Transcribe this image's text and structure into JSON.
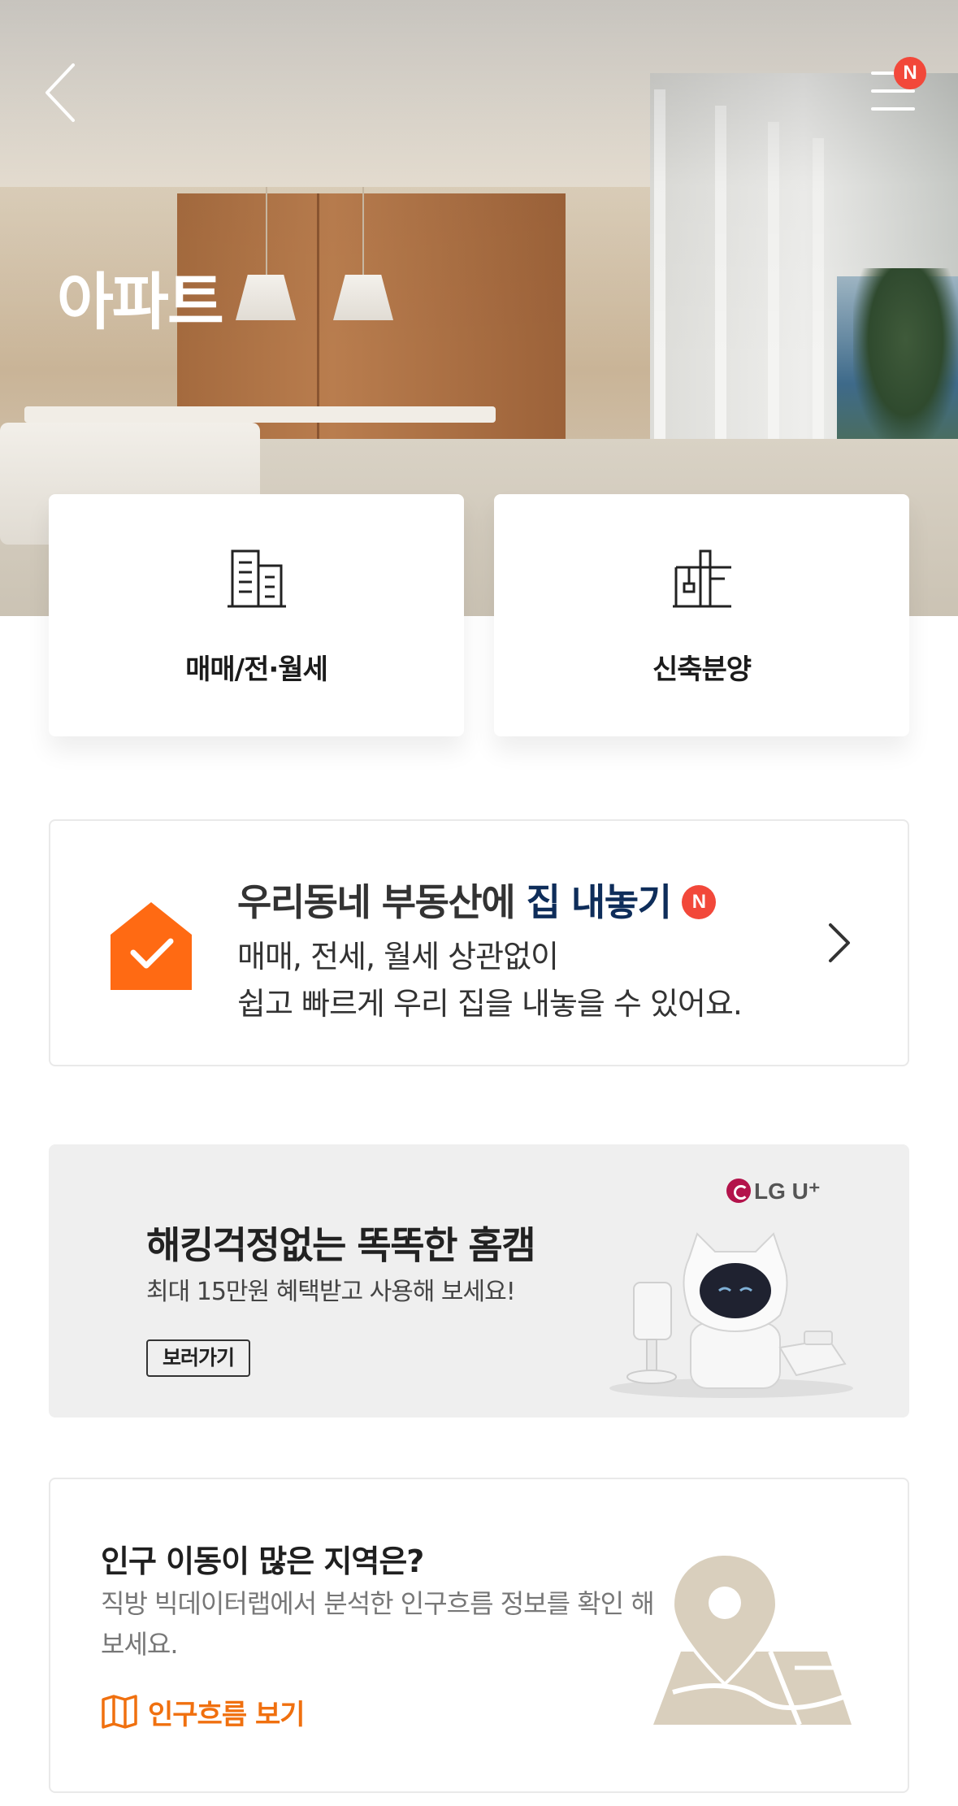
{
  "header": {
    "title": "아파트",
    "back_icon": "chevron-left-icon",
    "menu_icon": "hamburger-menu-icon",
    "menu_badge": "N"
  },
  "categories": [
    {
      "label": "매매/전·월세",
      "icon": "building-icon"
    },
    {
      "label": "신축분양",
      "icon": "crane-icon"
    }
  ],
  "listing_card": {
    "title_prefix": "우리동네 부동산에 ",
    "title_accent": "집 내놓기",
    "badge": "N",
    "desc_line1": "매매, 전세, 월세 상관없이",
    "desc_line2": "쉽고 빠르게 우리 집을 내놓을 수 있어요.",
    "icon": "house-check-icon",
    "accent_color": "#0e2d5a",
    "icon_color": "#ff6a13"
  },
  "ad_banner": {
    "brand": "LG U⁺",
    "title": "해킹걱정없는 똑똑한 홈캠",
    "subtitle": "최대 15만원 혜택받고 사용해 보세요!",
    "button_label": "보러가기"
  },
  "population_card": {
    "title": "인구 이동이 많은 지역은?",
    "desc": "직방 빅데이터랩에서 분석한 인구흐름 정보를 확인 해보세요.",
    "link_label": "인구흐름 보기",
    "link_color": "#f0700f"
  }
}
